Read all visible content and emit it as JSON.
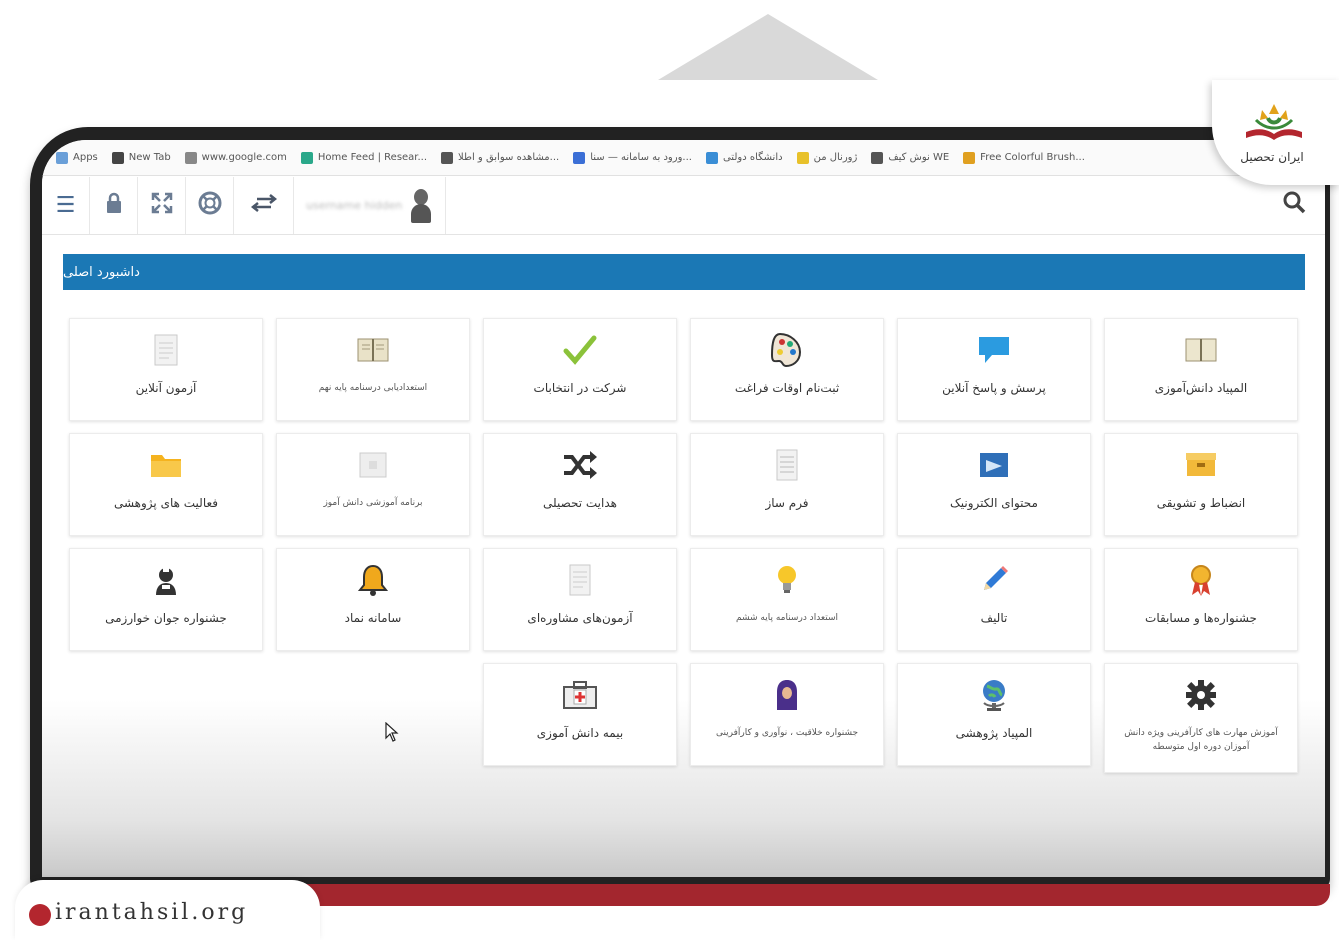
{
  "browser": {
    "bookmarks": [
      {
        "label": "Apps",
        "icon": "apps-grid-icon",
        "color": "#6a9fd8"
      },
      {
        "label": "New Tab",
        "icon": "globe-icon",
        "color": "#444444"
      },
      {
        "label": "www.google.com",
        "icon": "page-icon",
        "color": "#888888"
      },
      {
        "label": "Home Feed | Resear...",
        "icon": "rg-icon",
        "color": "#2aa88a"
      },
      {
        "label": "مشاهده سوابق و اطلا...",
        "icon": "camera-icon",
        "color": "#555555"
      },
      {
        "label": "ورود به سامانه — سنا...",
        "icon": "edge-icon",
        "color": "#3b6fd6"
      },
      {
        "label": "دانشگاه دولتی",
        "icon": "circle-icon",
        "color": "#3a8ed6"
      },
      {
        "label": "ژورنال من",
        "icon": "star-icon",
        "color": "#e8c12a"
      },
      {
        "label": "نوش كيف WE",
        "icon": "we-icon",
        "color": "#555555"
      },
      {
        "label": "Free Colorful Brush...",
        "icon": "brush-icon",
        "color": "#e0a020"
      }
    ]
  },
  "toolbar": {
    "user_name": "username hidden",
    "buttons": [
      "menu-icon",
      "lock-icon",
      "fullscreen-icon",
      "support-icon",
      "transfer-icon"
    ]
  },
  "titlebar": {
    "label": "داشبورد اصلی"
  },
  "tiles": {
    "r1c1": "آزمون آنلاین",
    "r1c2": "استعدادیابی درسنامه پایه نهم",
    "r1c3": "شرکت در انتخابات",
    "r1c4": "ثبت‌نام اوقات فراغت",
    "r1c5": "پرسش و پاسخ آنلاین",
    "r1c6": "المپیاد دانش‌آموزی",
    "r2c1": "فعالیت های پژوهشی",
    "r2c2": "برنامه آموزشی دانش آموز",
    "r2c3": "هدایت تحصیلی",
    "r2c4": "فرم ساز",
    "r2c5": "محتوای الکترونیک",
    "r2c6": "انضباط و تشویقی",
    "r3c1": "جشنواره جوان خوارزمی",
    "r3c2": "سامانه نماد",
    "r3c3": "آزمون‌های مشاوره‌ای",
    "r3c4": "استعداد درسنامه پایه ششم",
    "r3c5": "تالیف",
    "r3c6": "جشنواره‌ها و مسابقات",
    "r4c3": "بیمه دانش آموزی",
    "r4c4": "جشنواره خلاقیت ، نوآوری و کارآفرینی",
    "r4c5": "المپیاد پژوهشی",
    "r4c6": "آموزش مهارت های کارآفرینی ویژه دانش آموزان دوره اول متوسطه"
  },
  "watermark": {
    "text": "irantahsil.org"
  },
  "logo": {
    "text": "ایران تحصیل"
  }
}
